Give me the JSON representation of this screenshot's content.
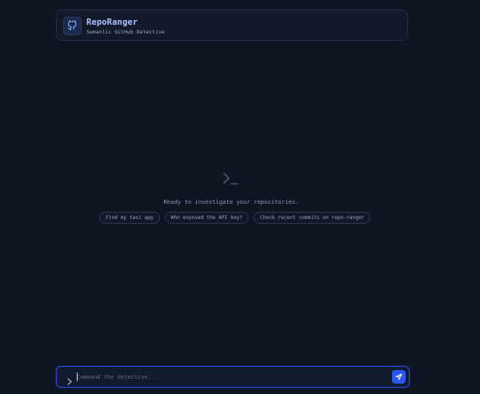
{
  "header": {
    "title": "RepoRanger",
    "subtitle": "Semantic GitHub Detective",
    "logo_icon": "github-octocat-icon"
  },
  "empty_state": {
    "icon": "terminal-prompt-icon",
    "message": "Ready to investigate your repositories.",
    "suggestions": [
      "Find my taxi app",
      "Who exposed the API key?",
      "Check recent commits on repo-ranger"
    ]
  },
  "command_bar": {
    "prefix_icon": "chevron-right-icon",
    "placeholder": "Command the detective...",
    "value": "",
    "send_icon": "send-icon"
  },
  "colors": {
    "background": "#0f1522",
    "accent": "#2b59f2",
    "title": "#a9c3ff"
  }
}
